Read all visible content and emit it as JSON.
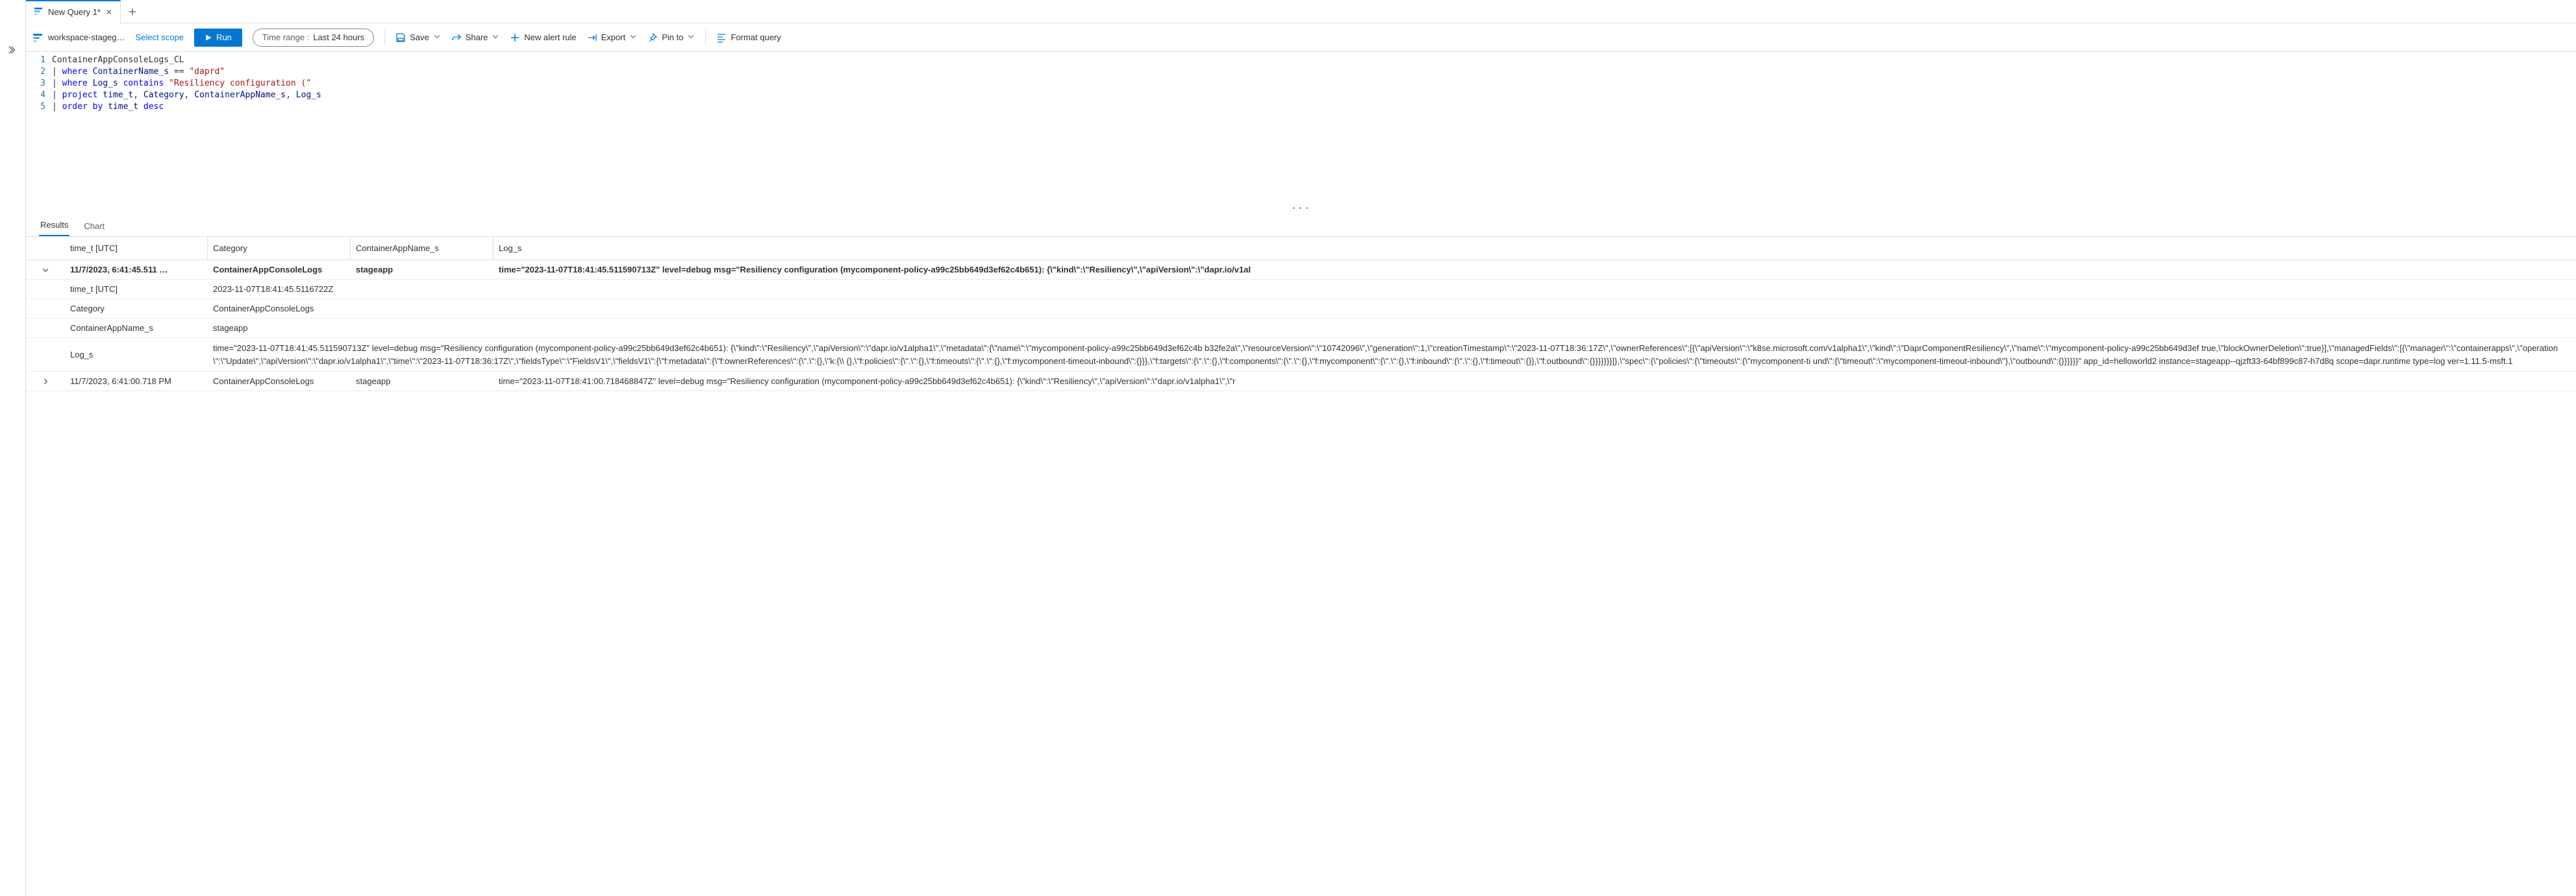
{
  "tabs": {
    "active": "New Query 1*"
  },
  "toolbar": {
    "workspace": "workspace-stageg…",
    "scope": "Select scope",
    "run": "Run",
    "timerange_label": "Time range :",
    "timerange_value": "Last 24 hours",
    "save": "Save",
    "share": "Share",
    "new_alert": "New alert rule",
    "export": "Export",
    "pin": "Pin to",
    "format": "Format query"
  },
  "editor": {
    "lines": [
      "ContainerAppConsoleLogs_CL",
      "| where ContainerName_s == \"daprd\"",
      "| where Log_s contains \"Resiliency configuration (\"",
      "| project time_t, Category, ContainerAppName_s, Log_s",
      "| order by time_t desc"
    ]
  },
  "results": {
    "tabs": {
      "results": "Results",
      "chart": "Chart"
    },
    "columns": [
      "time_t [UTC]",
      "Category",
      "ContainerAppName_s",
      "Log_s"
    ],
    "row_expanded": {
      "time_display": "11/7/2023, 6:41:45.511 …",
      "category": "ContainerAppConsoleLogs",
      "app": "stageapp",
      "log_preview": "time=\"2023-11-07T18:41:45.511590713Z\" level=debug msg=\"Resiliency configuration (mycomponent-policy-a99c25bb649d3ef62c4b651): {\\\"kind\\\":\\\"Resiliency\\\",\\\"apiVersion\\\":\\\"dapr.io/v1al",
      "details": {
        "time_t_utc_key": "time_t [UTC]",
        "time_t_utc_val": "2023-11-07T18:41:45.5116722Z",
        "category_key": "Category",
        "category_val": "ContainerAppConsoleLogs",
        "appname_key": "ContainerAppName_s",
        "appname_val": "stageapp",
        "log_key": "Log_s",
        "log_val": "time=\"2023-11-07T18:41:45.511590713Z\" level=debug msg=\"Resiliency configuration (mycomponent-policy-a99c25bb649d3ef62c4b651): {\\\"kind\\\":\\\"Resiliency\\\",\\\"apiVersion\\\":\\\"dapr.io/v1alpha1\\\",\\\"metadata\\\":{\\\"name\\\":\\\"mycomponent-policy-a99c25bb649d3ef62c4b b32fe2a\\\",\\\"resourceVersion\\\":\\\"10742096\\\",\\\"generation\\\":1,\\\"creationTimestamp\\\":\\\"2023-11-07T18:36:17Z\\\",\\\"ownerReferences\\\":[{\\\"apiVersion\\\":\\\"k8se.microsoft.com/v1alpha1\\\",\\\"kind\\\":\\\"DaprComponentResiliency\\\",\\\"name\\\":\\\"mycomponent-policy-a99c25bb649d3ef true,\\\"blockOwnerDeletion\\\":true}],\\\"managedFields\\\":[{\\\"manager\\\":\\\"containerapps\\\",\\\"operation\\\":\\\"Update\\\",\\\"apiVersion\\\":\\\"dapr.io/v1alpha1\\\",\\\"time\\\":\\\"2023-11-07T18:36:17Z\\\",\\\"fieldsType\\\":\\\"FieldsV1\\\",\\\"fieldsV1\\\":{\\\"f:metadata\\\":{\\\"f:ownerReferences\\\":{\\\".\\\":{},\\\"k:{\\\\ {},\\\"f:policies\\\":{\\\".\\\":{},\\\"f:timeouts\\\":{\\\".\\\":{},\\\"f:mycomponent-timeout-inbound\\\":{}}},\\\"f:targets\\\":{\\\".\\\":{},\\\"f:components\\\":{\\\".\\\":{},\\\"f:mycomponent\\\":{\\\".\\\":{},\\\"f:inbound\\\":{\\\".\\\":{},\\\"f:timeout\\\":{}},\\\"f:outbound\\\":{}}}}}}}]},\\\"spec\\\":{\\\"policies\\\":{\\\"timeouts\\\":{\\\"mycomponent-ti und\\\":{\\\"timeout\\\":\\\"mycomponent-timeout-inbound\\\"},\\\"outbound\\\":{}}}}}}\" app_id=helloworld2 instance=stageapp--qjzft33-64bf899c87-h7d8q scope=dapr.runtime type=log ver=1.11.5-msft.1"
      }
    },
    "row_collapsed": {
      "time_display": "11/7/2023, 6:41:00.718 PM",
      "category": "ContainerAppConsoleLogs",
      "app": "stageapp",
      "log_preview": "time=\"2023-11-07T18:41:00.718468847Z\" level=debug msg=\"Resiliency configuration (mycomponent-policy-a99c25bb649d3ef62c4b651): {\\\"kind\\\":\\\"Resiliency\\\",\\\"apiVersion\\\":\\\"dapr.io/v1alpha1\\\",\\\"r"
    }
  }
}
